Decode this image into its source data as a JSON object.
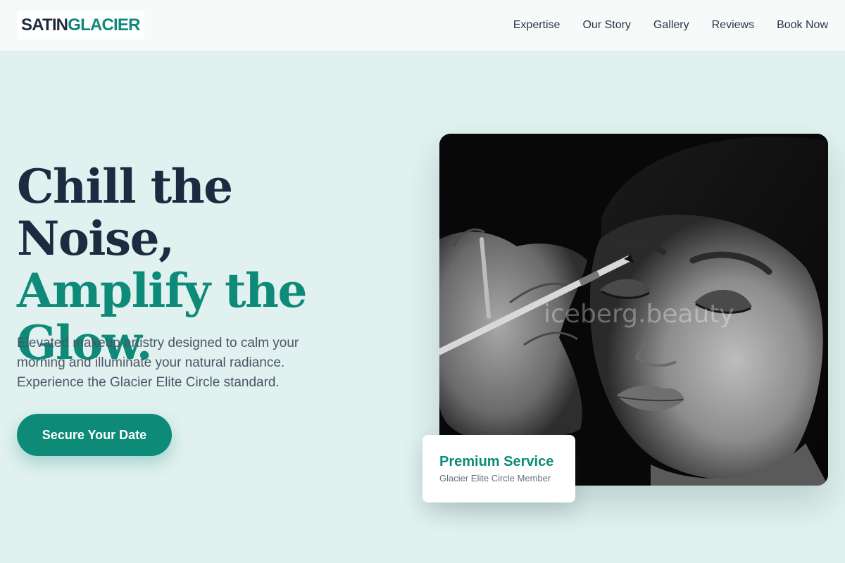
{
  "brand": {
    "part1": "SATIN",
    "part2": "GLACIER"
  },
  "nav": {
    "items": [
      {
        "label": "Expertise"
      },
      {
        "label": "Our Story"
      },
      {
        "label": "Gallery"
      },
      {
        "label": "Reviews"
      },
      {
        "label": "Book Now"
      }
    ]
  },
  "hero": {
    "title_line1": "Chill the Noise,",
    "title_line2": "Amplify the",
    "title_line3": "Glow.",
    "description": "Elevated makeup artistry designed to calm your morning and illuminate your natural radiance. Experience the Glacier Elite Circle standard.",
    "cta_label": "Secure Your Date"
  },
  "photo": {
    "watermark": "iceberg.beauty"
  },
  "badge": {
    "title": "Premium Service",
    "subtitle": "Glacier Elite Circle Member"
  },
  "colors": {
    "background": "#e0f1ef",
    "header": "#f6fbfa",
    "accent": "#0d8a78",
    "heading_dark": "#1c2b40",
    "body_text": "#4b5565"
  }
}
